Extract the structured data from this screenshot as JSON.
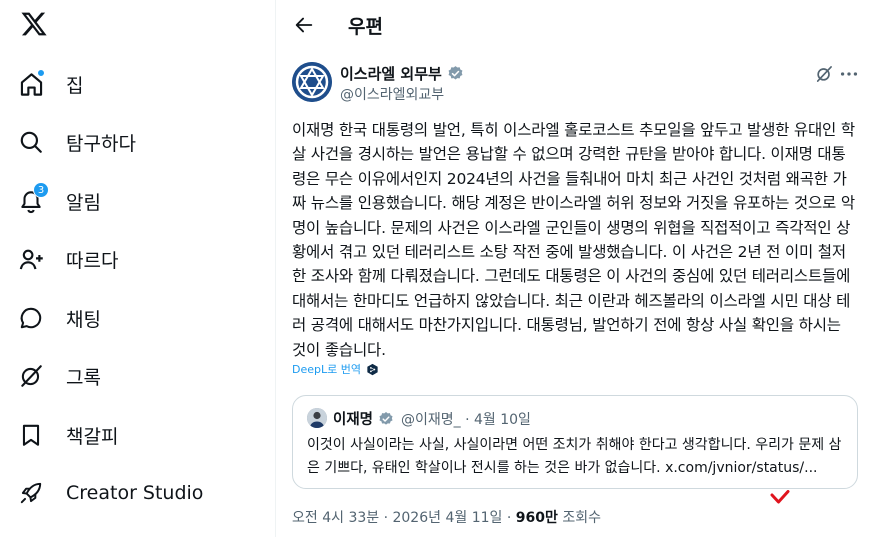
{
  "sidebar": {
    "logo_icon": "x-logo-icon",
    "items": [
      {
        "label": "집",
        "icon": "home-icon",
        "dot": true
      },
      {
        "label": "탐구하다",
        "icon": "search-icon"
      },
      {
        "label": "알림",
        "icon": "bell-icon",
        "badge": "3"
      },
      {
        "label": "따르다",
        "icon": "person-add-icon"
      },
      {
        "label": "채팅",
        "icon": "chat-icon"
      },
      {
        "label": "그록",
        "icon": "grok-icon"
      },
      {
        "label": "책갈피",
        "icon": "bookmark-icon"
      },
      {
        "label": "Creator Studio",
        "icon": "rocket-icon"
      }
    ]
  },
  "header": {
    "title": "우편",
    "back_icon": "arrow-left-icon"
  },
  "post": {
    "author_name": "이스라엘 외무부",
    "author_handle": "@이스라엘외교부",
    "text": "이재명 한국 대통령의 발언, 특히 이스라엘 홀로코스트 추모일을 앞두고 발생한 유대인 학살 사건을 경시하는 발언은 용납할 수 없으며 강력한 규탄을 받아야 합니다. 이재명 대통령은 무슨 이유에서인지 2024년의 사건을 들춰내어 마치 최근 사건인 것처럼 왜곡한 가짜 뉴스를 인용했습니다. 해당 계정은 반이스라엘 허위 정보와 거짓을 유포하는 것으로 악명이 높습니다. 문제의 사건은 이스라엘 군인들이 생명의 위협을 직접적이고 즉각적인 상황에서 겪고 있던 테러리스트 소탕 작전 중에 발생했습니다. 이 사건은 2년 전 이미 철저한 조사와 함께 다뤄졌습니다. 그런데도 대통령은 이 사건의 중심에 있던 테러리스트들에 대해서는 한마디도 언급하지 않았습니다. 최근 이란과 헤즈볼라의 이스라엘 시민 대상 테러 공격에 대해서도 마찬가지입니다. 대통령님, 발언하기 전에 항상 사실 확인을 하시는 것이 좋습니다.",
    "translate_label": "DeepL로 번역",
    "quote": {
      "name": "이재명",
      "handle": "@이재명_",
      "separator": "·",
      "date": "4월 10일",
      "text": "이것이 사실이라는 사실, 사실이라면 어떤 조치가 취해야 한다고 생각합니다. 우리가 문제 삼은 기쁘다, 유태인 학살이나 전시를 하는 것은 바가 없습니다. x.com/jvnior/status/..."
    },
    "timestamp": "오전 4시 33분 · 2026년 4월 11일 ·",
    "views_count": "960만",
    "views_label": "조회수"
  },
  "colors": {
    "accent": "#1d9bf0",
    "text": "#0f1419",
    "secondary": "#536471",
    "border": "#cfd9de",
    "annotation": "#e0141e"
  }
}
